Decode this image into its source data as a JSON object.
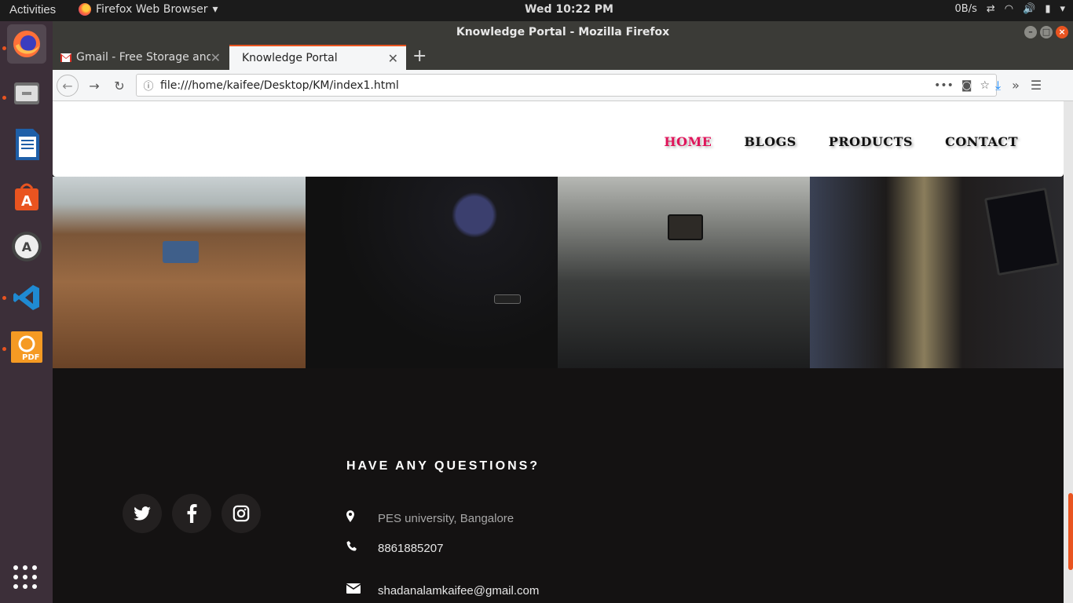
{
  "topbar": {
    "activities": "Activities",
    "app_menu": "Firefox Web Browser",
    "clock": "Wed 10:22 PM",
    "net_speed": "0B/s"
  },
  "window": {
    "title": "Knowledge Portal - Mozilla Firefox"
  },
  "tabs": [
    {
      "label": "Gmail - Free Storage and",
      "icon": "gmail-icon"
    },
    {
      "label": "Knowledge Portal",
      "icon": "none"
    }
  ],
  "urlbar": {
    "url": "file:///home/kaifee/Desktop/KM/index1.html"
  },
  "site": {
    "nav": [
      {
        "label": "HOME",
        "active": true
      },
      {
        "label": "BLOGS",
        "active": false
      },
      {
        "label": "PRODUCTS",
        "active": false
      },
      {
        "label": "CONTACT",
        "active": false
      }
    ],
    "accent_color": "#e0145a",
    "footer": {
      "title": "HAVE ANY QUESTIONS?",
      "address": "PES university, Bangalore",
      "phone": "8861885207",
      "email": "shadanalamkaifee@gmail.com"
    },
    "socials": [
      "twitter-icon",
      "facebook-icon",
      "instagram-icon"
    ]
  },
  "dock": [
    "firefox-icon",
    "files-icon",
    "writer-icon",
    "software-center-icon",
    "software-updater-icon",
    "vscode-icon",
    "pdf-editor-icon",
    "show-apps-icon"
  ]
}
